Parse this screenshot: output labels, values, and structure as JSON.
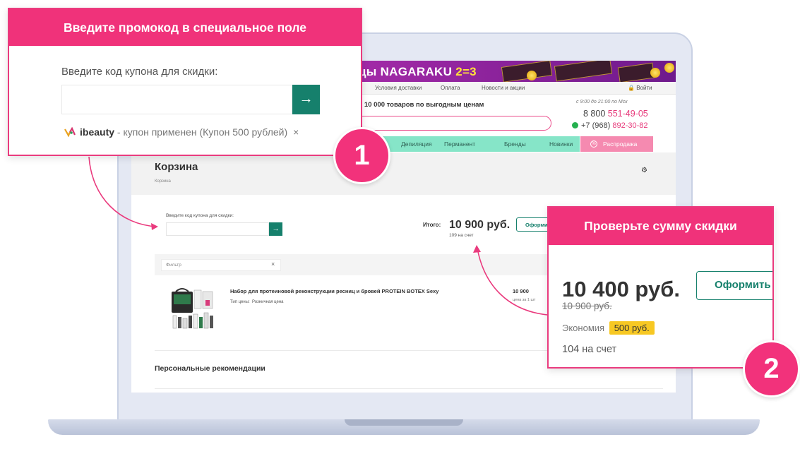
{
  "banner": {
    "text_prefix": "цы",
    "brand": "NAGARAKU",
    "promo": "2=3"
  },
  "topnav": {
    "items": [
      "Условия доставки",
      "Оплата",
      "Новости и акции"
    ],
    "login": "Войти"
  },
  "header": {
    "slogan": "е 10 000 товаров по выгодным ценам",
    "hours": "с 9:00 до 21:00 по Мск",
    "phone1_prefix": "8 800 ",
    "phone1_accent": "551-49-05",
    "phone2_prefix": "+7 (968) ",
    "phone2_accent": "892-30-82"
  },
  "categories": [
    "Депиляция",
    "Перманент",
    "Бренды",
    "Новинки"
  ],
  "sale_label": "Распродажа",
  "cart": {
    "title": "Корзина",
    "breadcrumb": "Корзина",
    "coupon_label": "Введите код купона для скидки:",
    "total_label": "Итого:",
    "total_value": "10 900 руб.",
    "bonus": "109 на счет",
    "order_button": "Оформить",
    "filter_placeholder": "Фильтр",
    "filter_clear": "×",
    "product": {
      "name": "Набор для протеиновой реконструкции ресниц и бровей PROTEIN BOTEX Sexy",
      "type_label": "Тип цены:",
      "type_value": "Розничная цена",
      "price": "10 900",
      "unit": "цена за 1 шт"
    },
    "recommendations": "Персональные рекомендации"
  },
  "callout1": {
    "title": "Введите промокод в специальное поле",
    "label": "Введите код купона для скидки:",
    "coupon_code": "ibeauty",
    "coupon_status": " - купон применен (Купон 500 рублей)",
    "remove": "×"
  },
  "callout2": {
    "title": "Проверьте сумму скидки",
    "price": "10 400 руб.",
    "old_price": "10 900 руб.",
    "economy_label": "Экономия",
    "economy_value": "500 руб.",
    "bonus": "104 на счет",
    "order_button": "Оформить"
  },
  "badges": [
    "1",
    "2"
  ],
  "colors": {
    "accent_pink": "#f0327a",
    "accent_green": "#16806c",
    "mint": "#86e5c8",
    "badge_yellow": "#f7c823"
  }
}
